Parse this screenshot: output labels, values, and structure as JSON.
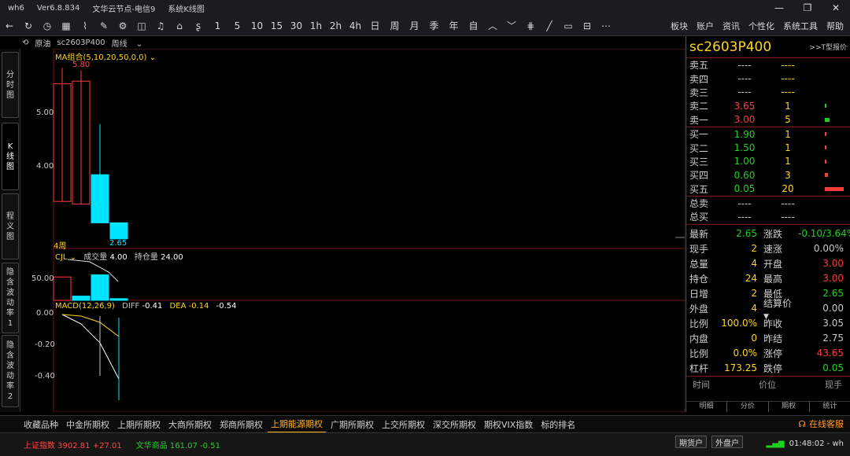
{
  "titlebar": {
    "app": "wh6",
    "version": "Ver6.8.834",
    "node": "文华云节点-电信9",
    "view": "系统K线图"
  },
  "toolbar": {
    "periods": [
      "1",
      "5",
      "10",
      "15",
      "30",
      "1h",
      "2h",
      "4h",
      "日",
      "周",
      "月",
      "季",
      "年",
      "自"
    ],
    "menus": [
      "板块",
      "账户",
      "资讯",
      "个性化",
      "系统工具",
      "帮助"
    ]
  },
  "subbar": {
    "oil": "原油",
    "symbol": "sc2603P400",
    "period": "周线"
  },
  "left_tabs": [
    "分时图",
    "K线图",
    "程义图",
    "隐含波动率1",
    "隐含波动率2"
  ],
  "chart": {
    "ma_label": "MA组合(5,10,20,50,0,0)",
    "high_label": "5.80",
    "low_label": "2.65",
    "period_tag": "4周",
    "y_price": [
      "5.00",
      "4.00"
    ],
    "vol_title": "CJL",
    "vol_label": "成交量",
    "vol_value": "4.00",
    "oi_label": "持仓量",
    "oi_value": "24.00",
    "vol_y": "50.00",
    "macd_label": "MACD(12,26,9)",
    "diff_label": "DIFF",
    "diff_value": "-0.41",
    "dea_label": "DEA",
    "dea_value": "-0.14",
    "macd_value": "-0.54",
    "macd_y": [
      "0.00",
      "-0.20",
      "-0.40"
    ]
  },
  "chart_data": {
    "type": "candlestick",
    "price": [
      {
        "open": 3.35,
        "close": 5.55,
        "high": 5.85,
        "low": 3.35
      },
      {
        "open": 3.3,
        "close": 5.6,
        "high": 5.8,
        "low": 3.3
      },
      {
        "open": 3.85,
        "close": 2.95,
        "high": 4.8,
        "low": 2.95
      },
      {
        "open": 2.95,
        "close": 2.65,
        "high": 2.95,
        "low": 2.65
      }
    ],
    "volume": [
      55,
      10,
      60,
      4
    ],
    "macd_lines": {
      "diff": [
        0.0,
        -0.06,
        -0.18,
        -0.41
      ],
      "dea": [
        0.0,
        -0.01,
        -0.05,
        -0.14
      ]
    },
    "price_ylim": [
      2.35,
      6.4
    ],
    "macd_ylim": [
      -0.55,
      0.02
    ]
  },
  "quote": {
    "symbol": "sc2603P400",
    "link": ">>T型报价",
    "asks": [
      {
        "label": "卖五",
        "price": "----",
        "vol": "----"
      },
      {
        "label": "卖四",
        "price": "----",
        "vol": "----"
      },
      {
        "label": "卖三",
        "price": "----",
        "vol": "----"
      },
      {
        "label": "卖二",
        "price": "3.65",
        "vol": "1",
        "bar": 1
      },
      {
        "label": "卖一",
        "price": "3.00",
        "vol": "5",
        "bar": 5
      }
    ],
    "bids": [
      {
        "label": "买一",
        "price": "1.90",
        "vol": "1",
        "bar": 1
      },
      {
        "label": "买二",
        "price": "1.50",
        "vol": "1",
        "bar": 1
      },
      {
        "label": "买三",
        "price": "1.00",
        "vol": "1",
        "bar": 1
      },
      {
        "label": "买四",
        "price": "0.60",
        "vol": "3",
        "bar": 3
      },
      {
        "label": "买五",
        "price": "0.05",
        "vol": "20",
        "bar": 20
      }
    ],
    "totals": [
      {
        "label": "总卖",
        "a": "----",
        "b": "----"
      },
      {
        "label": "总买",
        "a": "----",
        "b": "----"
      }
    ],
    "stats": [
      {
        "l1": "最新",
        "v1": "2.65",
        "c1": "green",
        "l2": "涨跌",
        "v2": "-0.10/3.64%",
        "c2": "green"
      },
      {
        "l1": "现手",
        "v1": "2",
        "c1": "ylw",
        "l2": "速涨",
        "v2": "0.00%",
        "c2": "dim"
      },
      {
        "l1": "总量",
        "v1": "4",
        "c1": "ylw",
        "l2": "开盘",
        "v2": "3.00",
        "c2": "red"
      },
      {
        "l1": "持仓",
        "v1": "24",
        "c1": "ylw",
        "l2": "最高",
        "v2": "3.00",
        "c2": "red"
      },
      {
        "l1": "日增",
        "v1": "2",
        "c1": "ylw",
        "l2": "最低",
        "v2": "2.65",
        "c2": "green"
      },
      {
        "l1": "外盘",
        "v1": "4",
        "c1": "ylw",
        "l2": "结算价",
        "v2": "0.00",
        "c2": "dim"
      },
      {
        "l1": "比例",
        "v1": "100.0%",
        "c1": "ylw",
        "l2": "昨收",
        "v2": "3.05",
        "c2": "dim"
      },
      {
        "l1": "内盘",
        "v1": "0",
        "c1": "ylw",
        "l2": "昨结",
        "v2": "2.75",
        "c2": "dim"
      },
      {
        "l1": "比例",
        "v1": "0.0%",
        "c1": "ylw",
        "l2": "涨停",
        "v2": "43.65",
        "c2": "red"
      },
      {
        "l1": "杠杆",
        "v1": "173.25",
        "c1": "ylw",
        "l2": "跌停",
        "v2": "0.05",
        "c2": "green"
      }
    ],
    "trade_head": [
      "时间",
      "价位",
      "现手"
    ],
    "tabs": [
      "明细",
      "分价",
      "期权",
      "统计"
    ]
  },
  "bottom_tabs": [
    "收藏品种",
    "中金所期权",
    "上期所期权",
    "大商所期权",
    "郑商所期权",
    "上期能源期权",
    "广期所期权",
    "上交所期权",
    "深交所期权",
    "期权VIX指数",
    "标的排名"
  ],
  "bottom_active": 5,
  "service": "在线客服",
  "status": {
    "index1": "上证指数  3902.81  +27.01",
    "index2": "文华商品  161.07  -0.51",
    "btn1": "期货户",
    "btn2": "外盘户",
    "time": "01:48:02 - wh"
  },
  "colors": {
    "up": "#ff3b3b",
    "down": "#00e5ff",
    "accent": "#ffd51a",
    "grid": "#7a1515"
  }
}
